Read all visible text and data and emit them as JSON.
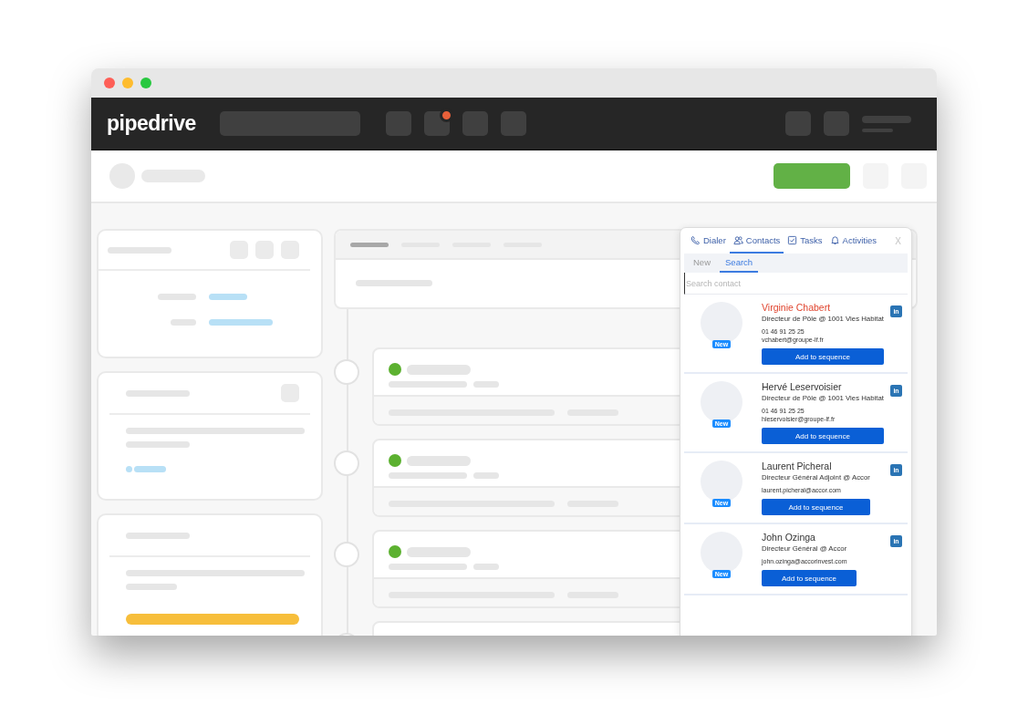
{
  "app": {
    "logo": "pipedrive"
  },
  "panel": {
    "tabs": [
      {
        "label": "Dialer",
        "selected": false
      },
      {
        "label": "Contacts",
        "selected": true
      },
      {
        "label": "Tasks",
        "selected": false
      },
      {
        "label": "Activities",
        "selected": false
      }
    ],
    "close": "X",
    "subtabs": [
      {
        "label": "New",
        "selected": false
      },
      {
        "label": "Search",
        "selected": true
      }
    ],
    "search": {
      "placeholder": "Search contact"
    },
    "contacts": [
      {
        "name": "Virginie Chabert",
        "highlighted": true,
        "title": "Directeur de Pôle @ 1001 Vies Habitat",
        "phone": "01 46 91 25 25",
        "email": "vchabert@groupe-lf.fr",
        "badge": "New",
        "linkedin": "in",
        "action": "Add to sequence"
      },
      {
        "name": "Hervé Leservoisier",
        "highlighted": false,
        "title": "Directeur de Pôle @ 1001 Vies Habitat",
        "phone": "01 46 91 25 25",
        "email": "hleservoisier@groupe-lf.fr",
        "badge": "New",
        "linkedin": "in",
        "action": "Add to sequence"
      },
      {
        "name": "Laurent Picheral",
        "highlighted": false,
        "title": "Directeur Général Adjoint @ Accor",
        "email": "laurent.picheral@accor.com",
        "badge": "New",
        "linkedin": "in",
        "action": "Add to sequence"
      },
      {
        "name": "John Ozinga",
        "highlighted": false,
        "title": "Directeur Général @ Accor",
        "email": "john.ozinga@accorinvest.com",
        "badge": "New",
        "linkedin": "in",
        "action": "Add to sequence"
      }
    ]
  }
}
